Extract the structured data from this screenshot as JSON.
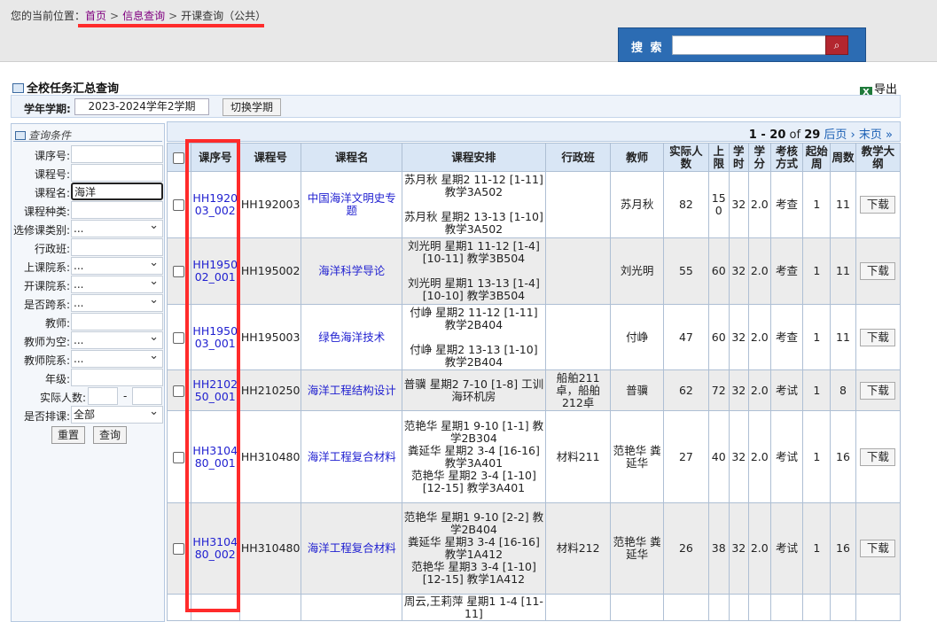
{
  "breadcrumb": {
    "prefix": "您的当前位置：",
    "home": "首页",
    "sep": ">",
    "info": "信息查询",
    "current": "开课查询（公共）"
  },
  "search": {
    "label": "搜 索",
    "placeholder": "",
    "button_icon": "magnifier-icon"
  },
  "page": {
    "title": "全校任务汇总查询",
    "export_label": "导出"
  },
  "term": {
    "label": "学年学期:",
    "value": "2023-2024学年2学期",
    "switch_label": "切换学期"
  },
  "filter": {
    "title": "查询条件",
    "fields": [
      {
        "label": "课序号:",
        "value": ""
      },
      {
        "label": "课程号:",
        "value": ""
      },
      {
        "label": "课程名:",
        "value": "海洋"
      },
      {
        "label": "课程种类:",
        "value": ""
      },
      {
        "label": "选修课类别:",
        "value": "..."
      },
      {
        "label": "行政班:",
        "value": ""
      },
      {
        "label": "上课院系:",
        "value": "..."
      },
      {
        "label": "开课院系:",
        "value": "..."
      },
      {
        "label": "是否跨系:",
        "value": "..."
      },
      {
        "label": "教师:",
        "value": ""
      },
      {
        "label": "教师为空:",
        "value": "..."
      },
      {
        "label": "教师院系:",
        "value": "..."
      },
      {
        "label": "年级:",
        "value": ""
      }
    ],
    "headcount_label": "实际人数:",
    "range_sep": "-",
    "scheduled_label": "是否排课:",
    "scheduled_value": "全部",
    "reset_label": "重置",
    "query_label": "查询"
  },
  "pager": {
    "range": "1 - 20",
    "of": "of",
    "total": "29",
    "next": "后页 ›",
    "last": "末页 »"
  },
  "table": {
    "headers": [
      "课序号",
      "课程号",
      "课程名",
      "课程安排",
      "行政班",
      "教师",
      "实际人数",
      "上限",
      "学时",
      "学分",
      "考核方式",
      "起始周",
      "周数",
      "教学大纲"
    ],
    "rows": [
      {
        "seq": "HH192003_002",
        "course_no": "HH192003",
        "name": "中国海洋文明史专题",
        "schedule": [
          "苏月秋 星期2 11-12 [1-11] 教学3A502",
          "苏月秋 星期2 13-13 [1-10] 教学3A502"
        ],
        "class": "",
        "teacher": "苏月秋",
        "actual": "82",
        "limit": "150",
        "hours": "32",
        "credit": "2.0",
        "exam": "考查",
        "start": "1",
        "weeks": "11",
        "dl": "下载"
      },
      {
        "seq": "HH195002_001",
        "course_no": "HH195002",
        "name": "海洋科学导论",
        "schedule": [
          "刘光明 星期1 11-12 [1-4] [10-11] 教学3B504",
          "刘光明 星期1 13-13 [1-4] [10-10] 教学3B504"
        ],
        "class": "",
        "teacher": "刘光明",
        "actual": "55",
        "limit": "60",
        "hours": "32",
        "credit": "2.0",
        "exam": "考查",
        "start": "1",
        "weeks": "11",
        "dl": "下载"
      },
      {
        "seq": "HH195003_001",
        "course_no": "HH195003",
        "name": "绿色海洋技术",
        "schedule": [
          "付峥 星期2 11-12 [1-11] 教学2B404",
          "付峥 星期2 13-13 [1-10] 教学2B404"
        ],
        "class": "",
        "teacher": "付峥",
        "actual": "47",
        "limit": "60",
        "hours": "32",
        "credit": "2.0",
        "exam": "考查",
        "start": "1",
        "weeks": "11",
        "dl": "下载"
      },
      {
        "seq": "HH210250_001",
        "course_no": "HH210250",
        "name": "海洋工程结构设计",
        "schedule": [
          "普骥 星期2 7-10 [1-8] 工训海环机房"
        ],
        "class": "船舶211卓，船舶212卓",
        "teacher": "普骥",
        "actual": "62",
        "limit": "72",
        "hours": "32",
        "credit": "2.0",
        "exam": "考试",
        "start": "1",
        "weeks": "8",
        "dl": "下载"
      },
      {
        "seq": "HH310480_001",
        "course_no": "HH310480",
        "name": "海洋工程复合材料",
        "schedule": [
          "范艳华 星期1 9-10 [1-1] 教学2B304",
          "粪延华 星期2 3-4 [16-16] 教学3A401",
          "范艳华 星期2 3-4 [1-10] [12-15] 教学3A401"
        ],
        "class": "材料211",
        "teacher": "范艳华 粪延华",
        "actual": "27",
        "limit": "40",
        "hours": "32",
        "credit": "2.0",
        "exam": "考试",
        "start": "1",
        "weeks": "16",
        "dl": "下载"
      },
      {
        "seq": "HH310480_002",
        "course_no": "HH310480",
        "name": "海洋工程复合材料",
        "schedule": [
          "范艳华 星期1 9-10 [2-2] 教学2B404",
          "粪延华 星期3 3-4 [16-16] 教学1A412",
          "范艳华 星期3 3-4 [1-10] [12-15] 教学1A412"
        ],
        "class": "材料212",
        "teacher": "范艳华 粪延华",
        "actual": "26",
        "limit": "38",
        "hours": "32",
        "credit": "2.0",
        "exam": "考试",
        "start": "1",
        "weeks": "16",
        "dl": "下载"
      },
      {
        "seq": "",
        "course_no": "",
        "name": "",
        "schedule": [
          "周云,王莉萍 星期1 1-4 [11-11]"
        ],
        "class": "",
        "teacher": "",
        "actual": "",
        "limit": "",
        "hours": "",
        "credit": "",
        "exam": "",
        "start": "",
        "weeks": "",
        "dl": ""
      }
    ]
  }
}
